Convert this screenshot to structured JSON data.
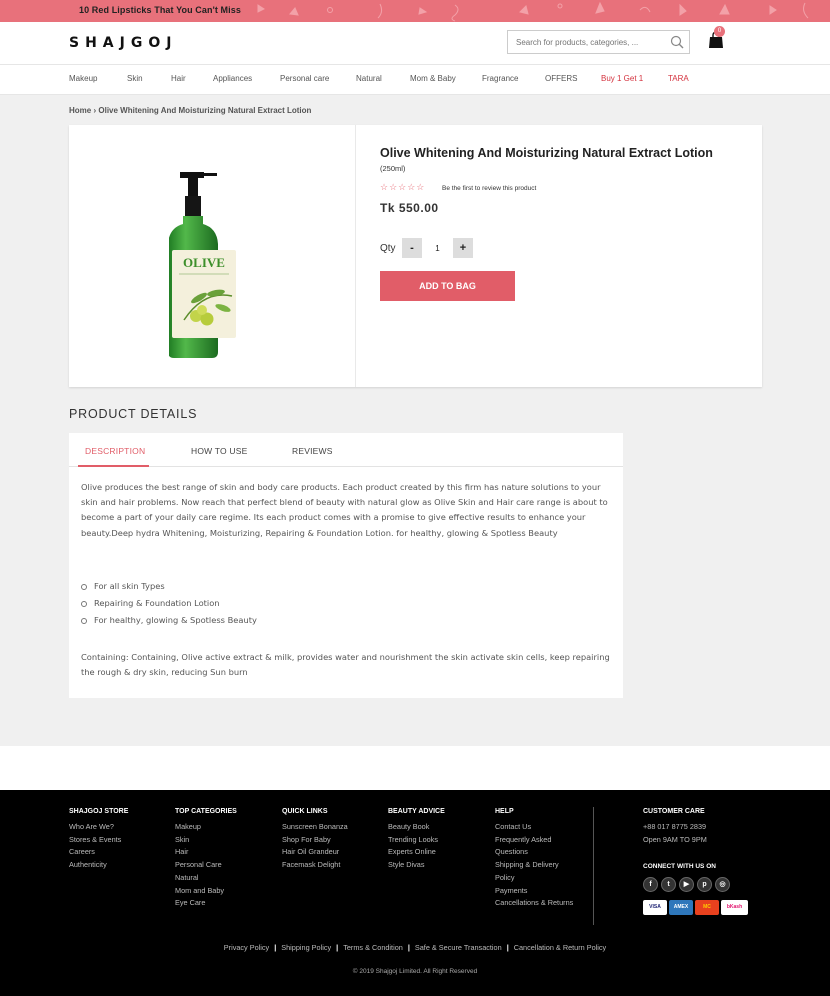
{
  "promo": {
    "text": "10 Red Lipsticks That You Can't Miss",
    "bg_color": "#e8717b"
  },
  "header": {
    "logo": "SHAJGOJ",
    "search_placeholder": "Search for products, categories, ...",
    "cart_count": "0"
  },
  "nav": {
    "items": [
      {
        "label": "Makeup"
      },
      {
        "label": "Skin"
      },
      {
        "label": "Hair"
      },
      {
        "label": "Appliances"
      },
      {
        "label": "Personal care"
      },
      {
        "label": "Natural"
      },
      {
        "label": "Mom & Baby"
      },
      {
        "label": "Fragrance"
      },
      {
        "label": "OFFERS"
      },
      {
        "label": "Buy 1 Get 1"
      },
      {
        "label": "TARA"
      }
    ]
  },
  "breadcrumb": {
    "home": "Home",
    "separator": "›",
    "current": "Olive Whitening And Moisturizing Natural Extract Lotion"
  },
  "product": {
    "title": "Olive Whitening And Moisturizing Natural Extract Lotion",
    "size": "(250ml)",
    "stars": "☆☆☆☆☆",
    "rating_value": 0,
    "review_text": "Be the first to review this product",
    "price": "Tk 550.00",
    "qty_label": "Qty",
    "qty_minus": "-",
    "qty_plus": "+",
    "qty_value": "1",
    "add_to_bag": "ADD TO BAG",
    "accent_color": "#e15d68",
    "bottle_label": "OLIVE"
  },
  "details": {
    "section_title": "PRODUCT DETAILS",
    "tabs": [
      {
        "label": "DESCRIPTION",
        "active": true
      },
      {
        "label": "HOW TO USE",
        "active": false
      },
      {
        "label": "REVIEWS",
        "active": false
      }
    ],
    "description": "Olive produces the best range of skin and body care products. Each product created by this firm has nature solutions to your skin and hair problems. Now reach that perfect blend of beauty with natural glow as Olive Skin and Hair care range is about to become a part of your daily care regime. Its each product comes with a promise to give effective results to enhance your beauty.Deep hydra Whitening, Moisturizing, Repairing & Foundation Lotion. for healthy, glowing & Spotless Beauty",
    "bullets": [
      "For all skin Types",
      "Repairing & Foundation Lotion",
      "For healthy, glowing & Spotless Beauty"
    ],
    "containing": "Containing: Containing, Olive active extract & milk, provides water and nourishment the skin activate skin cells, keep repairing the rough & dry skin, reducing Sun burn"
  },
  "footer": {
    "columns": [
      {
        "heading": "SHAJGOJ STORE",
        "links": [
          "Who Are We?",
          "Stores & Events",
          "Careers",
          "Authenticity"
        ]
      },
      {
        "heading": "TOP CATEGORIES",
        "links": [
          "Makeup",
          "Skin",
          "Hair",
          "Personal Care",
          "Natural",
          "Mom and Baby",
          "Eye Care"
        ]
      },
      {
        "heading": "QUICK LINKS",
        "links": [
          "Sunscreen Bonanza",
          "Shop For Baby",
          "Hair Oil Grandeur",
          "Facemask Delight"
        ]
      },
      {
        "heading": "BEAUTY ADVICE",
        "links": [
          "Beauty Book",
          "Trending Looks",
          "Experts Online",
          "Style Divas"
        ]
      },
      {
        "heading": "HELP",
        "links": [
          "Contact Us",
          "Frequently Asked",
          "Questions",
          "Shipping & Delivery",
          "Policy",
          "Payments",
          "Cancellations & Returns"
        ]
      }
    ],
    "customer_care": {
      "heading": "CUSTOMER CARE",
      "phone": "+88 017 8775 2839",
      "hours": "Open 9AM TO 9PM"
    },
    "connect_heading": "CONNECT WITH US ON",
    "social": [
      {
        "icon": "facebook-icon",
        "glyph": "f"
      },
      {
        "icon": "twitter-icon",
        "glyph": "t"
      },
      {
        "icon": "youtube-icon",
        "glyph": "▶"
      },
      {
        "icon": "pinterest-icon",
        "glyph": "p"
      },
      {
        "icon": "instagram-icon",
        "glyph": "◎"
      }
    ],
    "payments": [
      {
        "name": "VISA",
        "bg": "#ffffff",
        "color": "#1a1f71"
      },
      {
        "name": "AMEX",
        "bg": "#2e77bb",
        "color": "#ffffff"
      },
      {
        "name": "MC",
        "bg": "#e8411e",
        "color": "#ffcc00"
      },
      {
        "name": "bKash",
        "bg": "#ffffff",
        "color": "#e2136e"
      }
    ],
    "bottom_links": [
      "Privacy Policy",
      "Shipping Policy",
      "Terms & Condition",
      "Safe & Secure Transaction",
      "Cancellation & Return Policy"
    ],
    "copyright": "© 2019 Shajgoj Limited. All Right Reserved"
  }
}
